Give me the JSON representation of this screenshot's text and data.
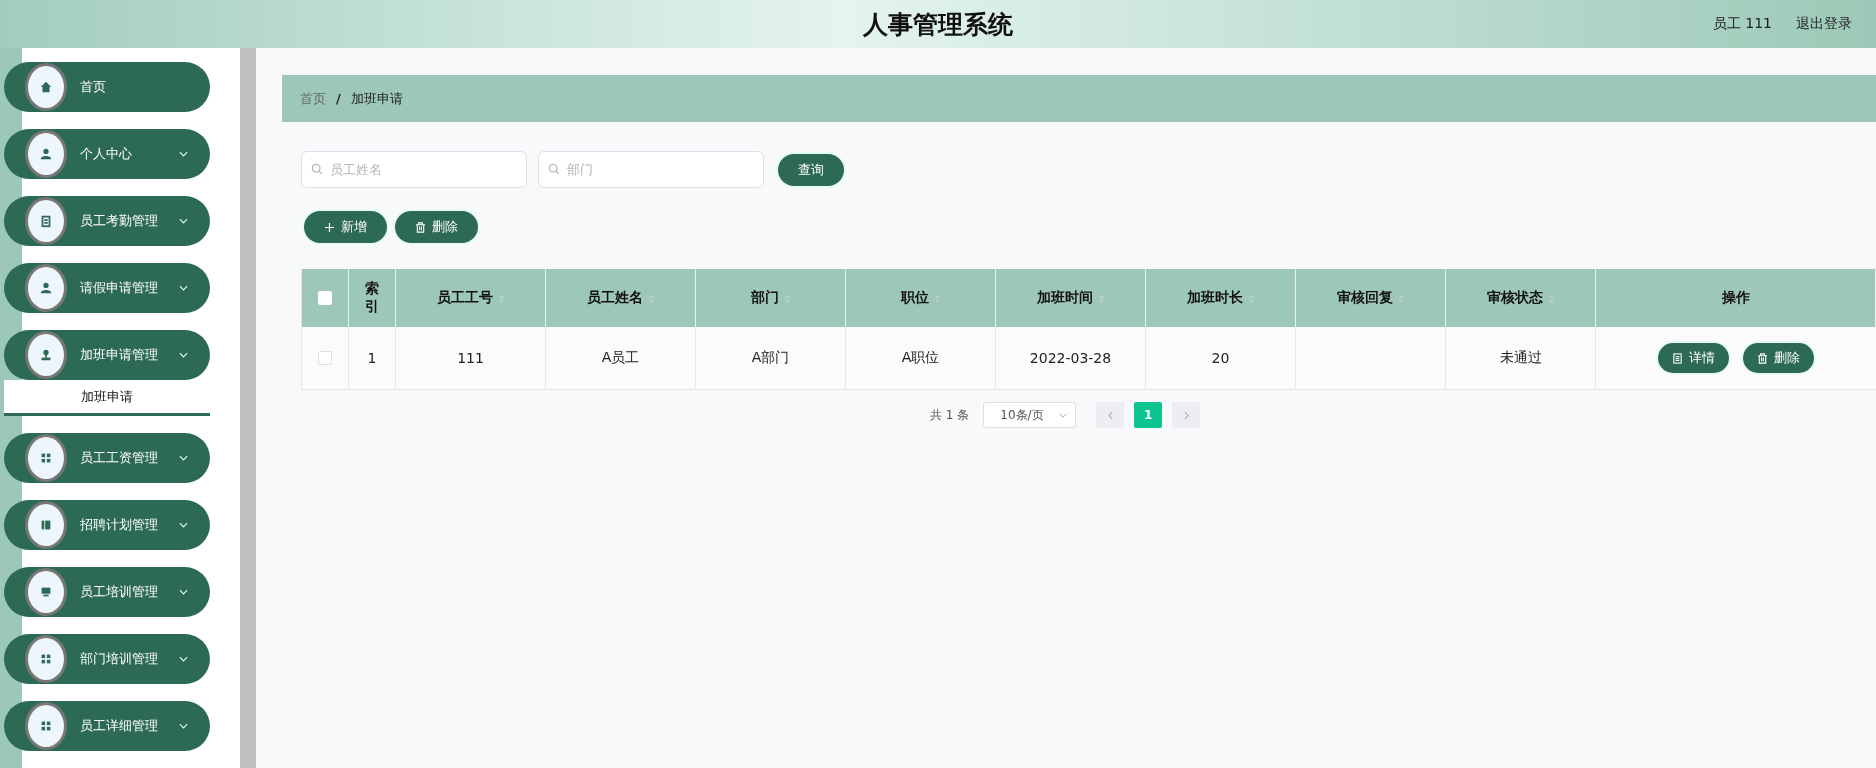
{
  "header": {
    "title": "人事管理系统",
    "user": "员工 111",
    "logout": "退出登录"
  },
  "menu": [
    {
      "label": "首页",
      "expandable": false
    },
    {
      "label": "个人中心",
      "expandable": true
    },
    {
      "label": "员工考勤管理",
      "expandable": true
    },
    {
      "label": "请假申请管理",
      "expandable": true
    },
    {
      "label": "加班申请管理",
      "expandable": true,
      "expanded": true,
      "children": [
        {
          "label": "加班申请",
          "selected": true
        }
      ]
    },
    {
      "label": "员工工资管理",
      "expandable": true
    },
    {
      "label": "招聘计划管理",
      "expandable": true
    },
    {
      "label": "员工培训管理",
      "expandable": true
    },
    {
      "label": "部门培训管理",
      "expandable": true
    },
    {
      "label": "员工详细管理",
      "expandable": true
    }
  ],
  "breadcrumb": {
    "items": [
      "首页",
      "加班申请"
    ],
    "separator": "/"
  },
  "search": [
    {
      "placeholder": "员工姓名"
    },
    {
      "placeholder": "部门"
    }
  ],
  "search_button": "查询",
  "actions": [
    "新增",
    "删除"
  ],
  "table": {
    "select_all_checked": false,
    "columns": [
      {
        "label": "索引",
        "sortable": false
      },
      {
        "label": "员工工号",
        "sortable": true
      },
      {
        "label": "员工姓名",
        "sortable": true
      },
      {
        "label": "部门",
        "sortable": true
      },
      {
        "label": "职位",
        "sortable": true
      },
      {
        "label": "加班时间",
        "sortable": true
      },
      {
        "label": "加班时长",
        "sortable": true
      },
      {
        "label": "审核回复",
        "sortable": true
      },
      {
        "label": "审核状态",
        "sortable": true
      },
      {
        "label": "操作",
        "sortable": false
      }
    ],
    "rows": [
      {
        "checked": false,
        "cells": [
          "1",
          "111",
          "A员工",
          "A部门",
          "A职位",
          "2022-03-28",
          "20",
          "",
          "未通过"
        ],
        "buttons": [
          "详情",
          "删除"
        ]
      }
    ]
  },
  "pagination": {
    "total": "共 1 条",
    "page_size": "10条/页",
    "pages": [
      {
        "label": "1",
        "selected": true
      }
    ]
  }
}
